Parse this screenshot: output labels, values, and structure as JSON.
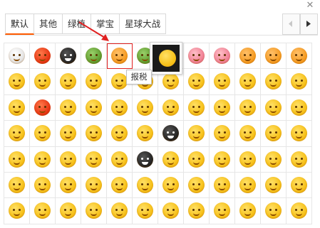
{
  "tabs": [
    {
      "label": "默认",
      "active": true
    },
    {
      "label": "其他",
      "active": false
    },
    {
      "label": "绿植",
      "active": false
    },
    {
      "label": "掌宝",
      "active": false
    },
    {
      "label": "星球大战",
      "active": false
    }
  ],
  "close_icon": "close-icon",
  "nav": {
    "prev_icon": "chevron-left-icon",
    "next_icon": "chevron-right-icon"
  },
  "tooltip": {
    "text": "报税"
  },
  "accent_color": "#ff5a00",
  "highlight_color": "#e02020",
  "emoji_grid": {
    "columns": 12,
    "rows": 7,
    "row_styles": [
      [
        "white",
        "red",
        "dark",
        "green",
        "orange",
        "green",
        "dark",
        "pink",
        "pink",
        "orange",
        "orange",
        "orange"
      ],
      [
        "std",
        "std",
        "std",
        "std",
        "std",
        "std",
        "std",
        "std",
        "std",
        "std",
        "std",
        "std"
      ],
      [
        "std",
        "red",
        "std",
        "std",
        "std",
        "std",
        "std",
        "std",
        "std",
        "std",
        "std",
        "std"
      ],
      [
        "std",
        "std",
        "std",
        "std",
        "std",
        "std",
        "dark",
        "std",
        "std",
        "std",
        "std",
        "std"
      ],
      [
        "std",
        "std",
        "std",
        "std",
        "std",
        "dark",
        "std",
        "std",
        "std",
        "std",
        "std",
        "std"
      ],
      [
        "std",
        "std",
        "std",
        "std",
        "std",
        "std",
        "std",
        "std",
        "std",
        "std",
        "std",
        "std"
      ],
      [
        "std",
        "std",
        "std",
        "std",
        "std",
        "std",
        "std",
        "std",
        "std",
        "std",
        "std",
        "std"
      ]
    ],
    "highlighted": {
      "row": 0,
      "col": 4
    }
  }
}
